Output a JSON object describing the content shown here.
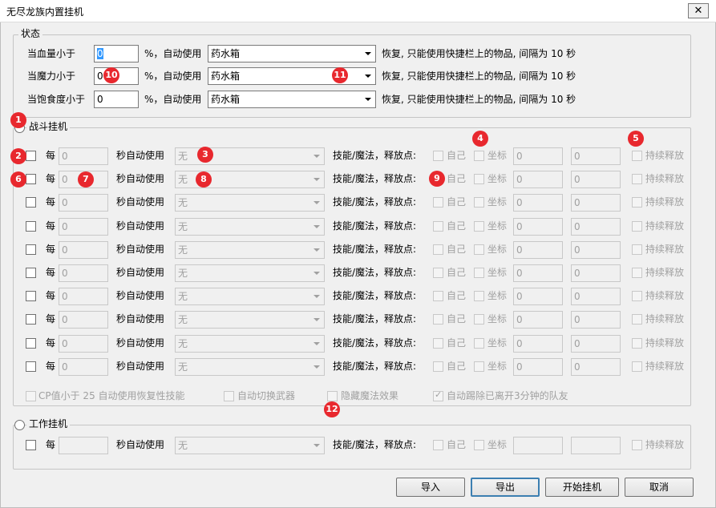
{
  "window": {
    "title": "无尽龙族内置挂机",
    "close_glyph": "✕"
  },
  "status": {
    "legend": "状态",
    "rows": [
      {
        "label": "当血量小于",
        "value": "0",
        "unit": "%，自动使用",
        "item": "药水箱",
        "suffix": "恢复, 只能使用快捷栏上的物品, 间隔为 10 秒"
      },
      {
        "label": "当魔力小于",
        "value": "0",
        "unit": "%，自动使用",
        "item": "药水箱",
        "suffix": "恢复, 只能使用快捷栏上的物品, 间隔为 10 秒"
      },
      {
        "label": "当饱食度小于",
        "value": "0",
        "unit": "%，自动使用",
        "item": "药水箱",
        "suffix": "恢复, 只能使用快捷栏上的物品, 间隔为 10 秒"
      }
    ]
  },
  "combat": {
    "legend": "战斗挂机",
    "every": "每",
    "sec_auto": "秒自动使用",
    "skill_label": "技能/魔法，释放点:",
    "self": "自己",
    "coord": "坐标",
    "continuous": "持续释放",
    "rows": [
      {
        "interval": "0",
        "skill": "无",
        "cx": "0",
        "cy": "0"
      },
      {
        "interval": "0",
        "skill": "无",
        "cx": "0",
        "cy": "0"
      },
      {
        "interval": "0",
        "skill": "无",
        "cx": "0",
        "cy": "0"
      },
      {
        "interval": "0",
        "skill": "无",
        "cx": "0",
        "cy": "0"
      },
      {
        "interval": "0",
        "skill": "无",
        "cx": "0",
        "cy": "0"
      },
      {
        "interval": "0",
        "skill": "无",
        "cx": "0",
        "cy": "0"
      },
      {
        "interval": "0",
        "skill": "无",
        "cx": "0",
        "cy": "0"
      },
      {
        "interval": "0",
        "skill": "无",
        "cx": "0",
        "cy": "0"
      },
      {
        "interval": "0",
        "skill": "无",
        "cx": "0",
        "cy": "0"
      },
      {
        "interval": "0",
        "skill": "无",
        "cx": "0",
        "cy": "0"
      }
    ],
    "options": {
      "cp_heal": "CP值小于 25 自动使用恢复性技能",
      "auto_switch_weapon": "自动切换武器",
      "hide_magic_fx": "隐藏魔法效果",
      "auto_kick": "自动踢除已离开3分钟的队友",
      "auto_kick_checked": true
    }
  },
  "work": {
    "legend": "工作挂机",
    "every": "每",
    "interval": "",
    "sec_auto": "秒自动使用",
    "skill": "无",
    "skill_label": "技能/魔法，释放点:",
    "self": "自己",
    "coord": "坐标",
    "cx": "",
    "cy": "",
    "continuous": "持续释放"
  },
  "buttons": {
    "import": "导入",
    "export": "导出",
    "start": "开始挂机",
    "cancel": "取消"
  },
  "badges": [
    "1",
    "2",
    "3",
    "4",
    "5",
    "6",
    "7",
    "8",
    "9",
    "10",
    "11",
    "12"
  ],
  "colors": {
    "badge": "#e8282e",
    "focus": "#3c7fb1"
  }
}
